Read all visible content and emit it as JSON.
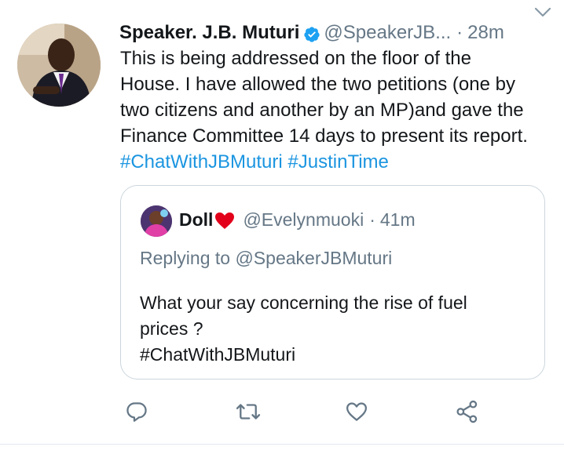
{
  "tweet": {
    "display_name": "Speaker. J.B. Muturi",
    "handle": "@SpeakerJB...",
    "separator": "·",
    "time": "28m",
    "text_lines": [
      "This is being addressed on the floor of the",
      "House. I have allowed the two petitions (one by",
      "two citizens and another by an MP)and gave the",
      "Finance Committee 14 days to present its report."
    ],
    "hashtags": [
      "#ChatWithJBMuturi",
      "#JustinTime"
    ]
  },
  "quoted_tweet": {
    "display_name": "Doll",
    "handle": "@Evelynmuoki",
    "separator": "·",
    "time": "41m",
    "replying_to": "Replying to @SpeakerJBMuturi",
    "text_lines": [
      "What your say concerning the rise of fuel",
      "prices ?",
      "#ChatWithJBMuturi"
    ]
  },
  "icons": {
    "verified": "verified-badge-icon",
    "menu": "chevron-down-icon",
    "heart_emoji": "red-heart-emoji",
    "reply": "reply-icon",
    "retweet": "retweet-icon",
    "like": "like-heart-icon",
    "share": "share-icon"
  },
  "colors": {
    "link_blue": "#1b95e0",
    "secondary_text": "#657786",
    "border": "#ccd6dd",
    "verified_blue": "#1da1f2",
    "heart_red": "#e0245e"
  }
}
